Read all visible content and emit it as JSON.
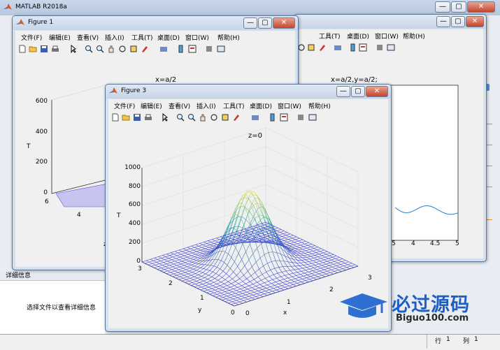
{
  "main": {
    "title": "MATLAB R2018a",
    "detail_header": "详细信息",
    "detail_text": "选择文件以查看详细信息",
    "status_row_label": "行",
    "status_row_value": "1",
    "status_col_label": "列",
    "status_col_value": "1"
  },
  "window_controls": {
    "minimize": "—",
    "maximize": "▢",
    "close": "✕"
  },
  "menu": {
    "file": "文件(F)",
    "edit": "编辑(E)",
    "view": "查看(V)",
    "insert": "插入(I)",
    "tools": "工具(T)",
    "desktop": "桌面(D)",
    "window": "窗口(W)",
    "help": "帮助(H)"
  },
  "figure1": {
    "title": "Figure 1",
    "plot_title": "x=a/2",
    "zlabel": "T",
    "z_ticks": [
      "600",
      "400",
      "200",
      "0"
    ],
    "y_ticks": [
      "6",
      "4"
    ],
    "extra_label": "z"
  },
  "figure2": {
    "plot_title": "x=a/2,y=a/2;",
    "x_ticks": [
      "5",
      "4",
      "4.5",
      "5"
    ]
  },
  "figure3": {
    "title": "Figure 3",
    "plot_title": "z=0",
    "zlabel": "T",
    "xlabel": "x",
    "ylabel": "y",
    "z_ticks": [
      "1000",
      "800",
      "600",
      "400",
      "200",
      "0"
    ],
    "y_ticks": [
      "3",
      "2",
      "1",
      "0"
    ],
    "x_ticks": [
      "0",
      "1",
      "2",
      "3"
    ]
  },
  "watermark": {
    "text": "必过源码",
    "url": "Biguo100.com"
  },
  "colors": {
    "mesh_low": "#3b3bd1",
    "mesh_high": "#f1e44a",
    "line": "#2c7fc9"
  }
}
